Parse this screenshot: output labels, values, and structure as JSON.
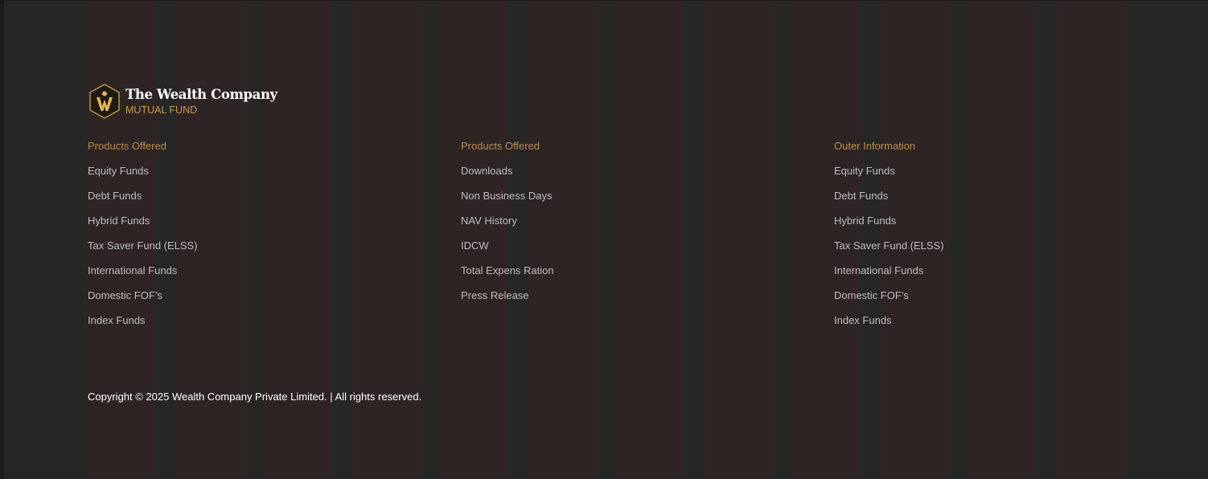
{
  "brand": {
    "name": "The Wealth Company",
    "subtitle": "MUTUAL FUND",
    "logo_icon": "wealth-company-logo",
    "accent_color": "#c69a4b"
  },
  "columns": [
    {
      "heading": "Products Offered",
      "links": [
        "Equity Funds",
        "Debt Funds",
        "Hybrid Funds",
        "Tax Saver Fund (ELSS)",
        "International Funds",
        "Domestic FOF’s",
        "Index Funds"
      ]
    },
    {
      "heading": "Products Offered",
      "links": [
        "Downloads",
        "Non Business Days",
        "NAV History",
        "IDCW",
        "Total Expens Ration",
        "Press Release"
      ]
    },
    {
      "heading": "Outer Information",
      "links": [
        "Equity Funds",
        "Debt Funds",
        "Hybrid Funds",
        "Tax Saver Fund (ELSS)",
        "International Funds",
        "Domestic FOF’s",
        "Index Funds"
      ]
    }
  ],
  "copyright": "Copyright © 2025 Wealth Company Private Limited. | All rights reserved."
}
